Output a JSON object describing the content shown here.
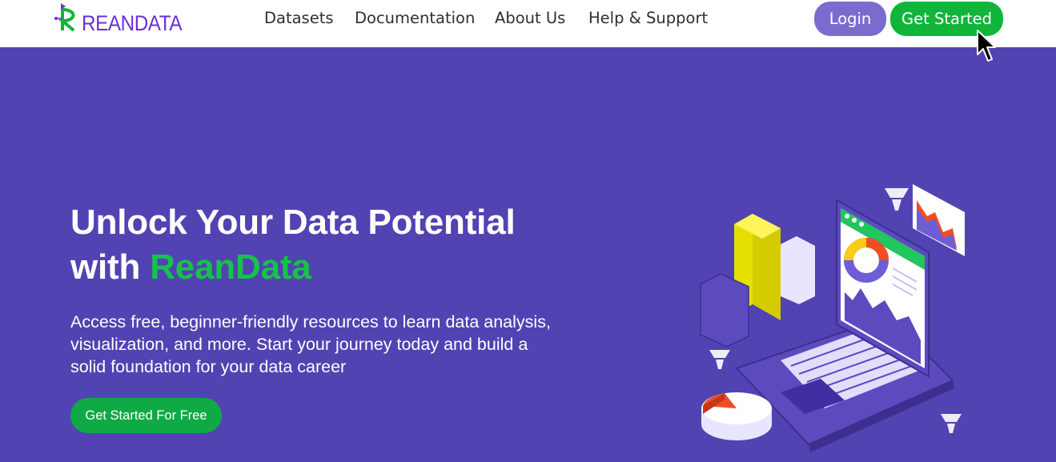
{
  "brand": {
    "name": "REANDATA",
    "accent": "#6b2fd8",
    "icon": "logo-r-mark"
  },
  "nav": {
    "links": [
      {
        "label": "Datasets"
      },
      {
        "label": "Documentation"
      },
      {
        "label": "About Us"
      },
      {
        "label": "Help & Support"
      }
    ],
    "login_label": "Login",
    "get_started_label": "Get Started"
  },
  "hero": {
    "title_line1": "Unlock Your Data Potential",
    "title_with": "with",
    "title_accent": "ReanData",
    "subtitle": "Access free, beginner-friendly resources to learn data analysis, visualization, and more. Start your journey today and build a solid foundation for your data career",
    "cta_label": "Get Started For Free",
    "illustration_icon": "laptop-analytics-illustration"
  },
  "colors": {
    "hero_background": "#5243b3",
    "header_background": "#ffffff",
    "primary_green": "#10b53a",
    "login_purple": "#7a6ccf",
    "accent_text_green": "#15c34a"
  }
}
